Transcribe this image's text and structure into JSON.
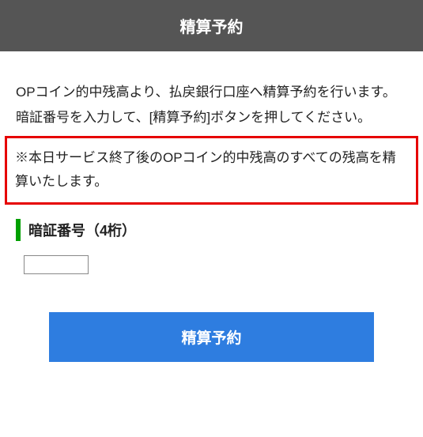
{
  "header": {
    "title": "精算予約"
  },
  "body": {
    "description1": "OPコイン的中残高より、払戻銀行口座へ精算予約を行います。",
    "description2": "暗証番号を入力して、[精算予約]ボタンを押してください。",
    "notice": "※本日サービス終了後のOPコイン的中残高のすべての残高を精算いたします。"
  },
  "field": {
    "label": "暗証番号（4桁）",
    "value": ""
  },
  "action": {
    "submit_label": "精算予約"
  }
}
